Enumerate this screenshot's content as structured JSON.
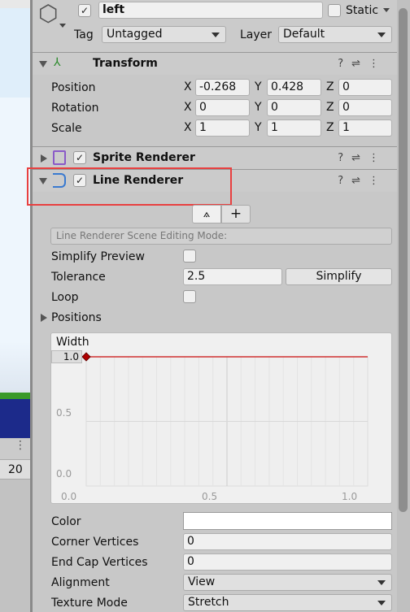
{
  "scene_view": {
    "count_label": "20"
  },
  "object": {
    "name": "left",
    "active": true,
    "static_label": "Static",
    "static": false,
    "tag_label": "Tag",
    "tag": "Untagged",
    "layer_label": "Layer",
    "layer": "Default",
    "icon": "cube-icon"
  },
  "transform": {
    "title": "Transform",
    "rows": [
      {
        "label": "Position",
        "x": "-0.268",
        "y": "0.428",
        "z": "0"
      },
      {
        "label": "Rotation",
        "x": "0",
        "y": "0",
        "z": "0"
      },
      {
        "label": "Scale",
        "x": "1",
        "y": "1",
        "z": "1"
      }
    ],
    "axes": [
      "X",
      "Y",
      "Z"
    ]
  },
  "sprite_renderer": {
    "title": "Sprite Renderer",
    "enabled": true
  },
  "line_renderer": {
    "title": "Line Renderer",
    "enabled": true,
    "highlight_color": "#e84040",
    "scene_mode_label": "Line Renderer Scene Editing Mode:",
    "simplify_preview_label": "Simplify Preview",
    "tolerance_label": "Tolerance",
    "tolerance": "2.5",
    "simplify_button": "Simplify",
    "loop_label": "Loop",
    "positions_label": "Positions",
    "width_curve": {
      "title": "Width",
      "y_ticks": [
        "1.0",
        "0.5",
        "0.0"
      ],
      "x_ticks": [
        "0.0",
        "0.5",
        "1.0"
      ],
      "value": 1.0,
      "curve_color": "#d03030"
    },
    "color_label": "Color",
    "color": "#ffffff",
    "corner_vertices_label": "Corner Vertices",
    "corner_vertices": "0",
    "end_cap_vertices_label": "End Cap Vertices",
    "end_cap_vertices": "0",
    "alignment_label": "Alignment",
    "alignment": "View",
    "texture_mode_label": "Texture Mode",
    "texture_mode": "Stretch"
  }
}
